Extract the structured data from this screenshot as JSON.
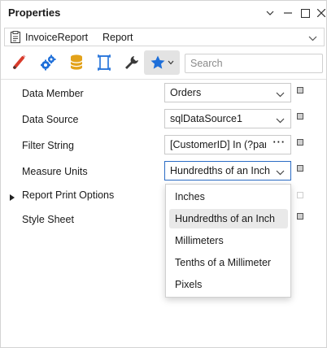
{
  "window": {
    "title": "Properties"
  },
  "object_selector": {
    "name": "InvoiceReport",
    "type": "Report"
  },
  "toolbar": {
    "search_placeholder": "Search"
  },
  "properties": [
    {
      "label": "Data Member",
      "value": "Orders"
    },
    {
      "label": "Data Source",
      "value": "sqlDataSource1"
    },
    {
      "label": "Filter String",
      "value": "[CustomerID] In (?par..."
    },
    {
      "label": "Measure Units",
      "value": "Hundredths of an Inch"
    },
    {
      "label": "Report Print Options"
    },
    {
      "label": "Style Sheet"
    }
  ],
  "measure_units_options": [
    "Inches",
    "Hundredths of an Inch",
    "Millimeters",
    "Tenths of a Millimeter",
    "Pixels"
  ],
  "icons": [
    "pencil-icon",
    "gears-icon",
    "database-icon",
    "page-icon",
    "wrench-icon",
    "star-icon"
  ],
  "colors": {
    "accent": "#1e6fd9",
    "marker": "#cfcfcf",
    "pencil_red": "#d93b2b",
    "database": "#e3a21a"
  }
}
